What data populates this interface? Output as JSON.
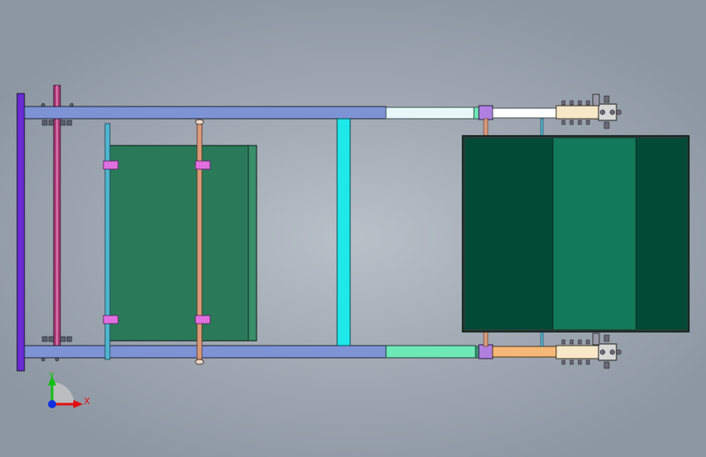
{
  "axis_triad": {
    "x_label": "X",
    "y_label": "Y"
  },
  "colors": {
    "background_center": "#b9c0c8",
    "background_edge": "#8d97a3",
    "rail_blue": "#7d93d6",
    "rail_outline": "#1a2030",
    "end_plate_purple": "#6a2bd6",
    "shaft_magenta": "#b03a7c",
    "rod_cyan": "#4fb6d0",
    "rod_copper": "#d89a78",
    "bracket_pink": "#e070e0",
    "tray_green": "#2a7a5a",
    "crossbar_cyan": "#1de8ea",
    "ext_white": "#e8f8f8",
    "ext_mint": "#6fe8b8",
    "block_lilac": "#b080e0",
    "ext_peach": "#f5b878",
    "panel_dark_green": "#004a36",
    "panel_mid_green": "#127a58",
    "clamp_cream": "#f8e8c8",
    "axis_x": "#e01010",
    "axis_y": "#10c010",
    "axis_z": "#1030e0"
  },
  "icons": {
    "axis_triad": "xyz-axis-triad-icon"
  }
}
